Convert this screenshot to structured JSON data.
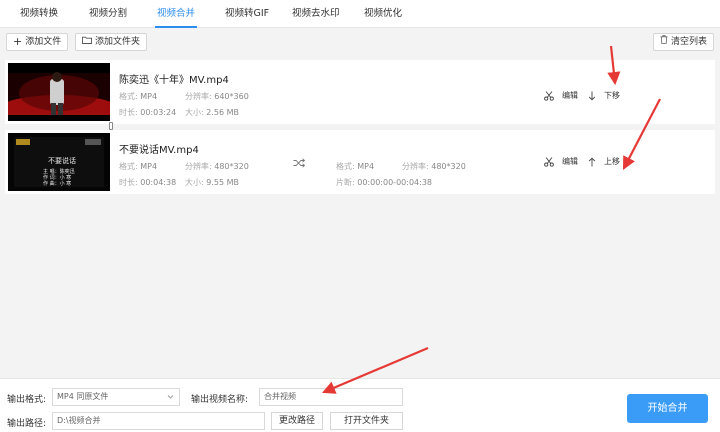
{
  "tabs": [
    {
      "label": "视频转换"
    },
    {
      "label": "视频分割"
    },
    {
      "label": "视频合并"
    },
    {
      "label": "视频转GIF"
    },
    {
      "label": "视频去水印"
    },
    {
      "label": "视频优化"
    }
  ],
  "toolbar": {
    "add_file": "添加文件",
    "add_folder": "添加文件夹",
    "clear_list": "清空列表"
  },
  "files": [
    {
      "name": "陈奕迅《十年》MV.mp4",
      "format_label": "格式:",
      "format": "MP4",
      "resolution_label": "分辨率:",
      "resolution": "640*360",
      "duration_label": "时长:",
      "duration": "00:03:24",
      "size_label": "大小:",
      "size": "2.56 MB",
      "edit_label": "编辑",
      "move_label": "下移"
    },
    {
      "name": "不要说话MV.mp4",
      "format_label": "格式:",
      "format": "MP4",
      "resolution_label": "分辨率:",
      "resolution": "480*320",
      "duration_label": "时长:",
      "duration": "00:04:38",
      "size_label": "大小:",
      "size": "9.55 MB",
      "out_format_label": "格式:",
      "out_format": "MP4",
      "out_resolution_label": "分辨率:",
      "out_resolution": "480*320",
      "segment_label": "片断:",
      "segment": "00:00:00-00:04:38",
      "edit_label": "编辑",
      "move_label": "上移"
    }
  ],
  "thumb_texts": {
    "title_2": "不要说话",
    "line1": "主 唱：陈奕迅",
    "line2": "作 词：小 寒",
    "line3": "作 曲：小 寒"
  },
  "output": {
    "format_label": "输出格式:",
    "format_value": "MP4  同原文件",
    "name_label": "输出视频名称:",
    "name_value": "合并视频",
    "path_label": "输出路径:",
    "path_value": "D:\\视频合并",
    "change_path": "更改路径",
    "open_folder": "打开文件夹",
    "start": "开始合并"
  },
  "colors": {
    "accent": "#2d8cf0",
    "primary_button": "#3b9cf7",
    "annotation_arrow": "#e53935"
  }
}
